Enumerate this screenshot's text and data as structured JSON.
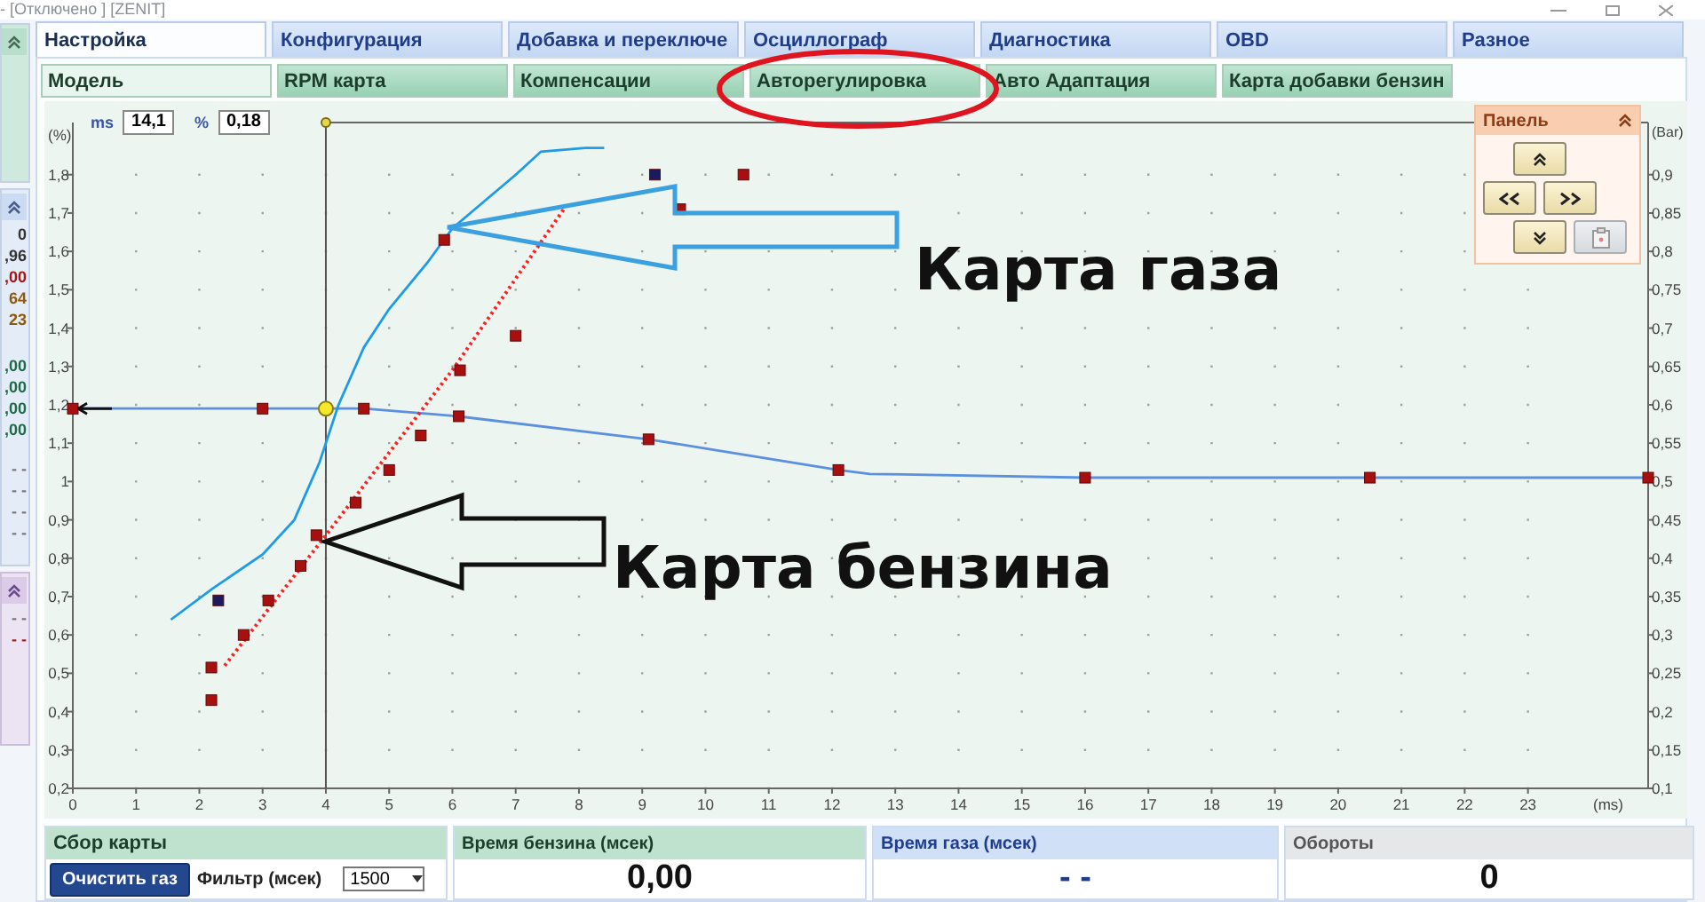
{
  "window": {
    "title": "- [Отключено ]  [ZENIT]"
  },
  "left_rail": {
    "values": [
      "0",
      ",96",
      ",00",
      "64",
      "23",
      ",00",
      ",00",
      ",00",
      ",00"
    ],
    "dashes": [
      "- -",
      "- -",
      "- -",
      "- -"
    ],
    "lower_dashes": [
      "- -",
      "- -"
    ]
  },
  "tabs": [
    {
      "label": "Настройка",
      "selected": true
    },
    {
      "label": "Конфигурация",
      "selected": false
    },
    {
      "label": "Добавка и переключе",
      "selected": false
    },
    {
      "label": "Осциллограф",
      "selected": false
    },
    {
      "label": "Диагностика",
      "selected": false
    },
    {
      "label": "OBD",
      "selected": false
    },
    {
      "label": "Разное",
      "selected": false
    }
  ],
  "subtabs": [
    {
      "label": "Модель",
      "selected": true,
      "highlighted": false
    },
    {
      "label": "RPM карта",
      "selected": false,
      "highlighted": false
    },
    {
      "label": "Компенсации",
      "selected": false,
      "highlighted": false
    },
    {
      "label": "Авторегулировка",
      "selected": false,
      "highlighted": true
    },
    {
      "label": "Авто Адаптация",
      "selected": false,
      "highlighted": false
    },
    {
      "label": "Карта добавки бензин",
      "selected": false,
      "highlighted": false
    }
  ],
  "readouts": [
    {
      "unit": "ms",
      "value": "14,1"
    },
    {
      "unit": "%",
      "value": "0,18"
    }
  ],
  "chart_data": {
    "type": "line",
    "xlabel": "(ms)",
    "ylabel": "(%)",
    "y2label": "(Bar)",
    "xlim": [
      0,
      24.9
    ],
    "ylim": [
      0.2,
      1.936
    ],
    "xticks": [
      0,
      1,
      2,
      3,
      4,
      5,
      6,
      7,
      8,
      9,
      10,
      11,
      12,
      13,
      14,
      15,
      16,
      17,
      18,
      19,
      20,
      21,
      22,
      23
    ],
    "yticks": [
      {
        "value": 0.2,
        "label": "0,2"
      },
      {
        "value": 0.3,
        "label": "0,3"
      },
      {
        "value": 0.4,
        "label": "0,4"
      },
      {
        "value": 0.5,
        "label": "0,5"
      },
      {
        "value": 0.6,
        "label": "0,6"
      },
      {
        "value": 0.7,
        "label": "0,7"
      },
      {
        "value": 0.8,
        "label": "0,8"
      },
      {
        "value": 0.9,
        "label": "0,9"
      },
      {
        "value": 1,
        "label": "1"
      },
      {
        "value": 1.1,
        "label": "1,1"
      },
      {
        "value": 1.2,
        "label": "1,2"
      },
      {
        "value": 1.3,
        "label": "1,3"
      },
      {
        "value": 1.4,
        "label": "1,4"
      },
      {
        "value": 1.5,
        "label": "1,5"
      },
      {
        "value": 1.6,
        "label": "1,6"
      },
      {
        "value": 1.7,
        "label": "1,7"
      },
      {
        "value": 1.8,
        "label": "1,8"
      }
    ],
    "y2ticks": [
      {
        "value": 0.1,
        "label": "0,1"
      },
      {
        "value": 0.15,
        "label": "0,15"
      },
      {
        "value": 0.2,
        "label": "0,2"
      },
      {
        "value": 0.25,
        "label": "0,25"
      },
      {
        "value": 0.3,
        "label": "0,3"
      },
      {
        "value": 0.35,
        "label": "0,35"
      },
      {
        "value": 0.4,
        "label": "0,4"
      },
      {
        "value": 0.45,
        "label": "0,45"
      },
      {
        "value": 0.5,
        "label": "0,5"
      },
      {
        "value": 0.55,
        "label": "0,55"
      },
      {
        "value": 0.6,
        "label": "0,6"
      },
      {
        "value": 0.65,
        "label": "0,65"
      },
      {
        "value": 0.7,
        "label": "0,7"
      },
      {
        "value": 0.75,
        "label": "0,75"
      },
      {
        "value": 0.8,
        "label": "0,8"
      },
      {
        "value": 0.85,
        "label": "0,85"
      },
      {
        "value": 0.9,
        "label": "0,9"
      }
    ],
    "y2lim": [
      0.1,
      0.968
    ],
    "series": [
      {
        "type": "line",
        "line_style": "solid",
        "color": "#5b8fe0",
        "x": [
          0,
          3,
          4.6,
          6.1,
          9.1,
          12.1,
          12.6,
          16,
          20.5,
          24.9
        ],
        "values": [
          1.19,
          1.19,
          1.19,
          1.17,
          1.11,
          1.03,
          1.02,
          1.01,
          1.01,
          1.01
        ]
      },
      {
        "type": "line",
        "line_style": "solid",
        "color": "#1e9be8",
        "x": [
          1.55,
          2.2,
          3,
          3.5,
          3.9,
          4.2,
          4.6,
          5,
          5.6,
          6,
          6.5,
          7,
          7.4,
          8.1,
          8.4
        ],
        "values": [
          0.64,
          0.72,
          0.81,
          0.9,
          1.05,
          1.2,
          1.35,
          1.45,
          1.57,
          1.66,
          1.73,
          1.8,
          1.86,
          1.87,
          1.87
        ]
      },
      {
        "type": "line",
        "line_style": "dotted",
        "color": "#ff2020",
        "x": [
          2.4,
          4,
          6,
          7.8
        ],
        "values": [
          0.52,
          0.86,
          1.29,
          1.72
        ]
      },
      {
        "type": "scatter",
        "color": "#a81010",
        "x": [
          0,
          3,
          4.6,
          6.1,
          9.1,
          12.1,
          16,
          20.5,
          24.9,
          2.19,
          2.19,
          2.7,
          3.09,
          3.6,
          3.85,
          4.47,
          5,
          5.5,
          5.87,
          6.12,
          7,
          9.6,
          10.6
        ],
        "values": [
          1.19,
          1.19,
          1.19,
          1.17,
          1.11,
          1.03,
          1.01,
          1.01,
          1.01,
          0.515,
          0.43,
          0.6,
          0.69,
          0.78,
          0.86,
          0.945,
          1.03,
          1.12,
          1.63,
          1.29,
          1.38,
          1.71,
          1.8
        ]
      },
      {
        "type": "scatter",
        "color": "#1a1a60",
        "x": [
          2.3,
          9.2
        ],
        "values": [
          0.69,
          1.8
        ]
      }
    ],
    "ref_lines": [
      {
        "axis": "x",
        "value": 4
      }
    ],
    "grid": true
  },
  "panel": {
    "title": "Панель",
    "buttons": [
      {
        "kind": "up",
        "disabled": false
      },
      {
        "kind": "left",
        "disabled": false
      },
      {
        "kind": "right",
        "disabled": false
      },
      {
        "kind": "down",
        "disabled": false
      },
      {
        "kind": "clear",
        "disabled": true
      }
    ]
  },
  "annotations": [
    {
      "kind": "gas",
      "text": "Карта газа"
    },
    {
      "kind": "petrol",
      "text": "Карта бензина"
    }
  ],
  "collect": {
    "title": "Сбор карты",
    "clear_button": "Очистить газ",
    "filter_label": "Фильтр (мсек)",
    "filter_value": "1500"
  },
  "meters": [
    {
      "kind": "petrol",
      "title": "Время бензина (мсек)",
      "value": "0,00"
    },
    {
      "kind": "gas",
      "title": "Время газа (мсек)",
      "value": "- -"
    },
    {
      "kind": "rpm",
      "title": "Обороты",
      "value": "0"
    }
  ]
}
